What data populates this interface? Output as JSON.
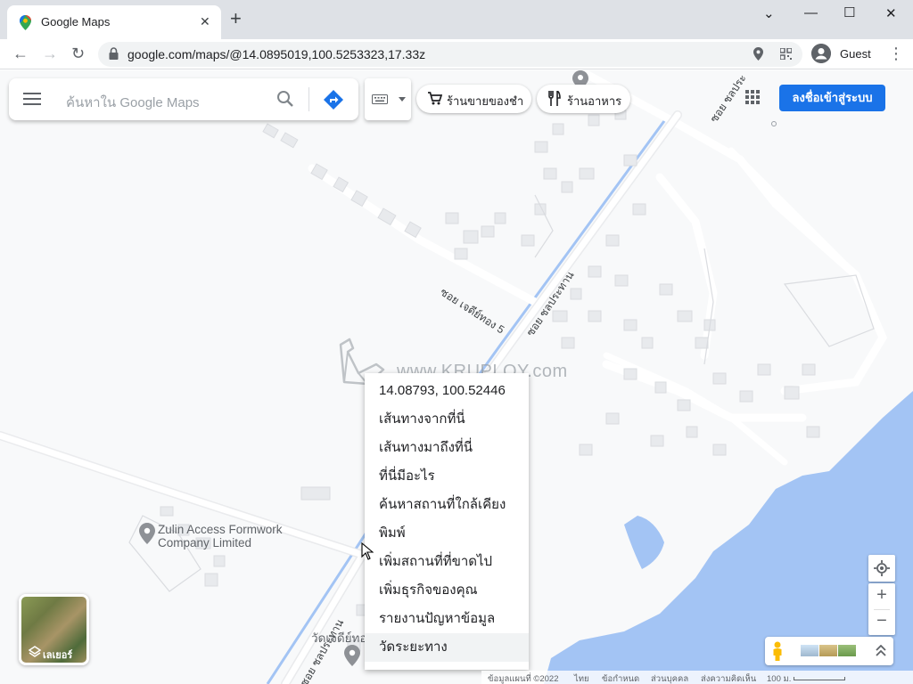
{
  "browser": {
    "tab_title": "Google Maps",
    "new_tab_icon": "plus-icon",
    "url": "google.com/maps/@14.0895019,100.5253323,17.33z",
    "profile_name": "Guest"
  },
  "maps": {
    "search_placeholder": "ค้นหาใน Google Maps",
    "chips": [
      "ร้านขายของชำ",
      "ร้านอาหาร"
    ],
    "signin_label": "ลงชื่อเข้าสู่ระบบ",
    "context_menu": [
      "14.08793, 100.52446",
      "เส้นทางจากที่นี่",
      "เส้นทางมาถึงที่นี่",
      "ที่นี่มีอะไร",
      "ค้นหาสถานที่ใกล้เคียง",
      "พิมพ์",
      "เพิ่มสถานที่ที่ขาดไป",
      "เพิ่มธุรกิจของคุณ",
      "รายงานปัญหาข้อมูล",
      "วัดระยะทาง"
    ],
    "place_label_line1": "Zulin Access Formwork",
    "place_label_line2": "Company Limited",
    "place_label_2": "วัดเจดีย์ทอ",
    "road_labels": [
      "ซอย เจดีย์ทอง 5",
      "ซอย ชลประทาน",
      "ซอย ชลประ",
      "ซอย ชลประทาน"
    ],
    "layers_label": "เลเยอร์",
    "zoom_in": "+",
    "zoom_out": "−",
    "footer": [
      "ข้อมูลแผนที่ ©2022",
      "ไทย",
      "ข้อกำหนด",
      "ส่วนบุคคล",
      "ส่งความคิดเห็น",
      "100 ม."
    ]
  },
  "watermark": "www.KRUPLOY.com",
  "colors": {
    "water": "#a3c4f4",
    "accent": "#1a73e8",
    "road": "#ffffff",
    "building": "#e8eaed"
  }
}
